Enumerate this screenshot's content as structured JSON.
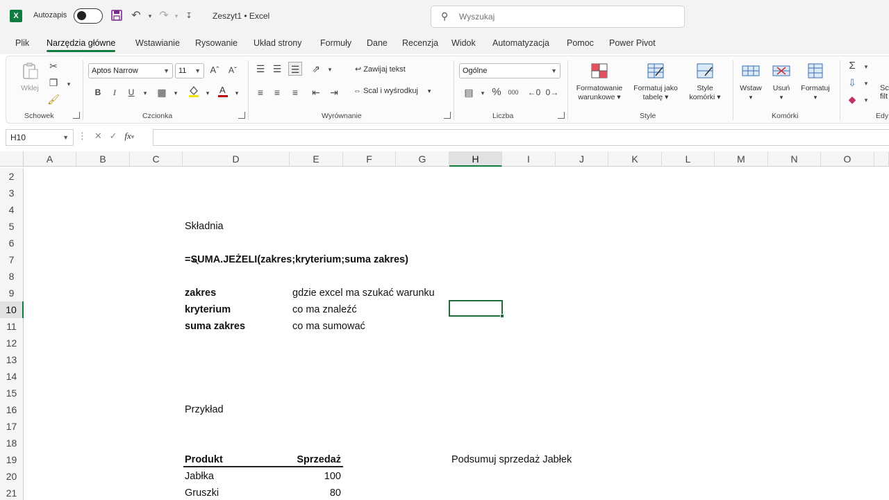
{
  "titlebar": {
    "autosave_label": "Autozapis",
    "doc_title": "Zeszyt1 • Excel",
    "search_placeholder": "Wyszukaj"
  },
  "tabs": [
    {
      "label": "Plik"
    },
    {
      "label": "Narzędzia główne"
    },
    {
      "label": "Wstawianie"
    },
    {
      "label": "Rysowanie"
    },
    {
      "label": "Układ strony"
    },
    {
      "label": "Formuły"
    },
    {
      "label": "Dane"
    },
    {
      "label": "Recenzja"
    },
    {
      "label": "Widok"
    },
    {
      "label": "Automatyzacja"
    },
    {
      "label": "Pomoc"
    },
    {
      "label": "Power Pivot"
    }
  ],
  "ribbon": {
    "clipboard": {
      "paste": "Wklej",
      "group": "Schowek"
    },
    "font": {
      "name": "Aptos Narrow",
      "size": "11",
      "bold": "B",
      "italic": "I",
      "underline": "U",
      "group": "Czcionka"
    },
    "alignment": {
      "wrap": "Zawijaj tekst",
      "merge": "Scal i wyśrodkuj",
      "group": "Wyrównanie"
    },
    "number": {
      "format": "Ogólne",
      "percent": "%",
      "thousands": "000",
      "group": "Liczba"
    },
    "styles": {
      "conditional_1": "Formatowanie",
      "conditional_2": "warunkowe ▾",
      "table_1": "Formatuj jako",
      "table_2": "tabelę ▾",
      "cell_1": "Style",
      "cell_2": "komórki ▾",
      "group": "Style"
    },
    "cells": {
      "insert": "Wstaw",
      "delete": "Usuń",
      "format": "Formatuj",
      "group": "Komórki"
    },
    "editing": {
      "sort_1": "Sc",
      "sort_2": "filt",
      "group": "Edy"
    }
  },
  "formula_bar": {
    "name_box": "H10",
    "fx": "fx",
    "value": ""
  },
  "columns": [
    "A",
    "B",
    "C",
    "D",
    "E",
    "F",
    "G",
    "H",
    "I",
    "J",
    "K",
    "L",
    "M",
    "N",
    "O"
  ],
  "selected_column": "H",
  "rows": [
    "2",
    "3",
    "4",
    "5",
    "6",
    "7",
    "8",
    "9",
    "10",
    "11",
    "12",
    "13",
    "14",
    "15",
    "16",
    "17",
    "18",
    "19",
    "20",
    "21"
  ],
  "selected_row": "10",
  "sheet": {
    "skladnia": "Składnia",
    "formula": "=SUMA.JEŻELI(zakres;kryterium;suma zakres)",
    "zakres": "zakres",
    "zakres_desc": "gdzie excel ma szukać warunku",
    "kryterium": "kryterium",
    "kryterium_desc": "co ma znaleźć",
    "suma_zakres": "suma zakres",
    "suma_zakres_desc": "co ma sumować",
    "przyklad": "Przykład",
    "header_produkt": "Produkt",
    "header_sprzedaz": "Sprzedaż",
    "task": "Podsumuj sprzedaż Jabłek",
    "data_rows": [
      {
        "produkt": "Jabłka",
        "sprzedaz": "100"
      },
      {
        "produkt": "Gruszki",
        "sprzedaz": "80"
      }
    ]
  },
  "colors": {
    "accent": "#107c41",
    "selection": "#1f6b3b"
  }
}
